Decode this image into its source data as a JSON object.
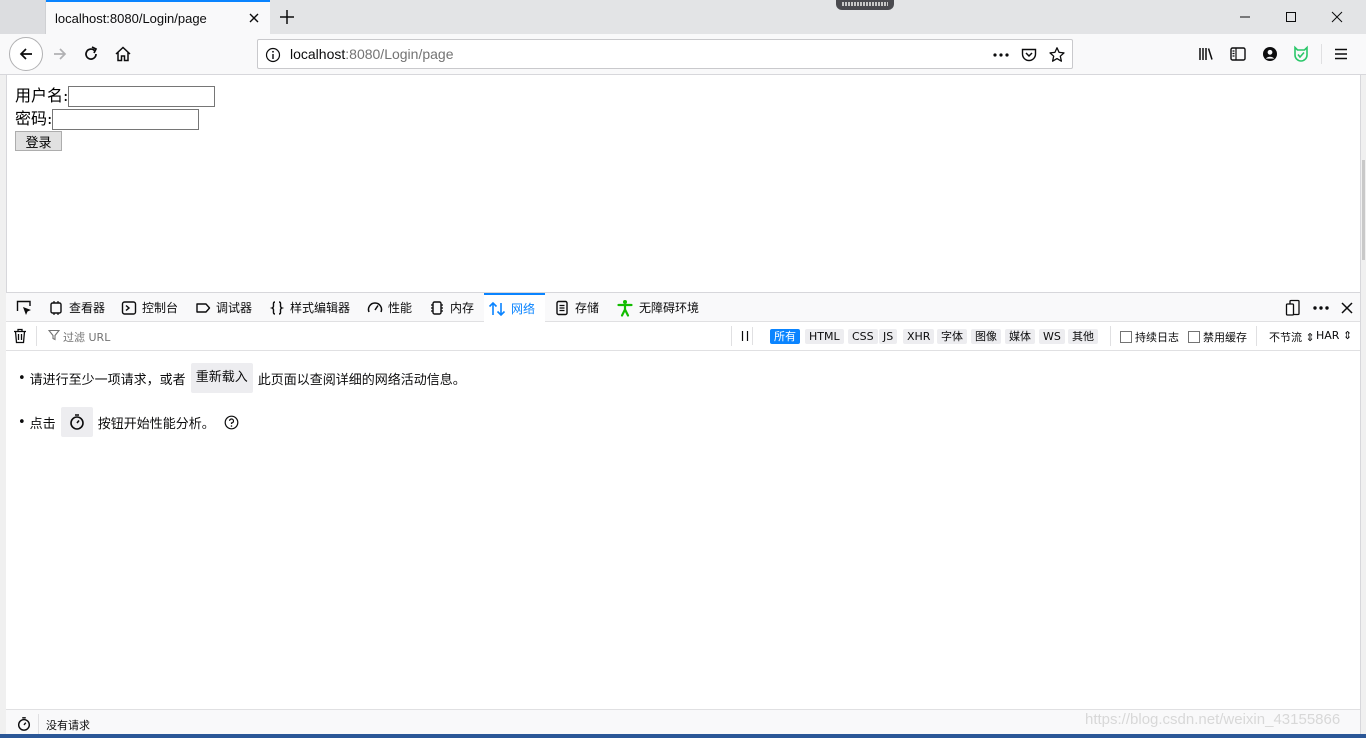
{
  "browser": {
    "tab_title": "localhost:8080/Login/page",
    "url_host": "localhost",
    "url_path": ":8080/Login/page",
    "icons": {
      "tab_close": "close-icon",
      "new_tab": "plus-icon",
      "back": "arrow-left-icon",
      "forward": "arrow-right-icon",
      "reload": "reload-icon",
      "home": "home-icon",
      "site_info": "info-icon",
      "page_actions": "ellipsis-icon",
      "pocket": "pocket-icon",
      "bookmark": "star-icon",
      "library": "library-icon",
      "sidebar": "sidebar-icon",
      "account": "account-icon",
      "extension": "extension-icon",
      "menu": "hamburger-icon"
    }
  },
  "page": {
    "username_label": "用户名:",
    "password_label": "密码:",
    "login_button": "登录"
  },
  "devtools": {
    "tabs": [
      {
        "label": "查看器",
        "icon": "inspector-icon"
      },
      {
        "label": "控制台",
        "icon": "console-icon"
      },
      {
        "label": "调试器",
        "icon": "debugger-icon"
      },
      {
        "label": "样式编辑器",
        "icon": "style-editor-icon"
      },
      {
        "label": "性能",
        "icon": "performance-icon"
      },
      {
        "label": "内存",
        "icon": "memory-icon"
      },
      {
        "label": "网络",
        "icon": "network-icon",
        "selected": true
      },
      {
        "label": "存储",
        "icon": "storage-icon"
      },
      {
        "label": "无障碍环境",
        "icon": "accessibility-icon"
      }
    ],
    "accent_color": "#0a84ff",
    "filter_placeholder": "过滤 URL",
    "type_filters": [
      "所有",
      "HTML",
      "CSS",
      "JS",
      "XHR",
      "字体",
      "图像",
      "媒体",
      "WS",
      "其他"
    ],
    "selected_type_filter": "所有",
    "persist_logs_label": "持续日志",
    "disable_cache_label": "禁用缓存",
    "throttle_label": "不节流",
    "har_label": "HAR",
    "notice_1_before": "请进行至少一项请求，或者",
    "notice_1_button": "重新载入",
    "notice_1_after": "此页面以查阅详细的网络活动信息。",
    "notice_2_before": "点击",
    "notice_2_after": "按钮开始性能分析。",
    "status_text": "没有请求"
  },
  "watermark": "https://blog.csdn.net/weixin_43155866"
}
